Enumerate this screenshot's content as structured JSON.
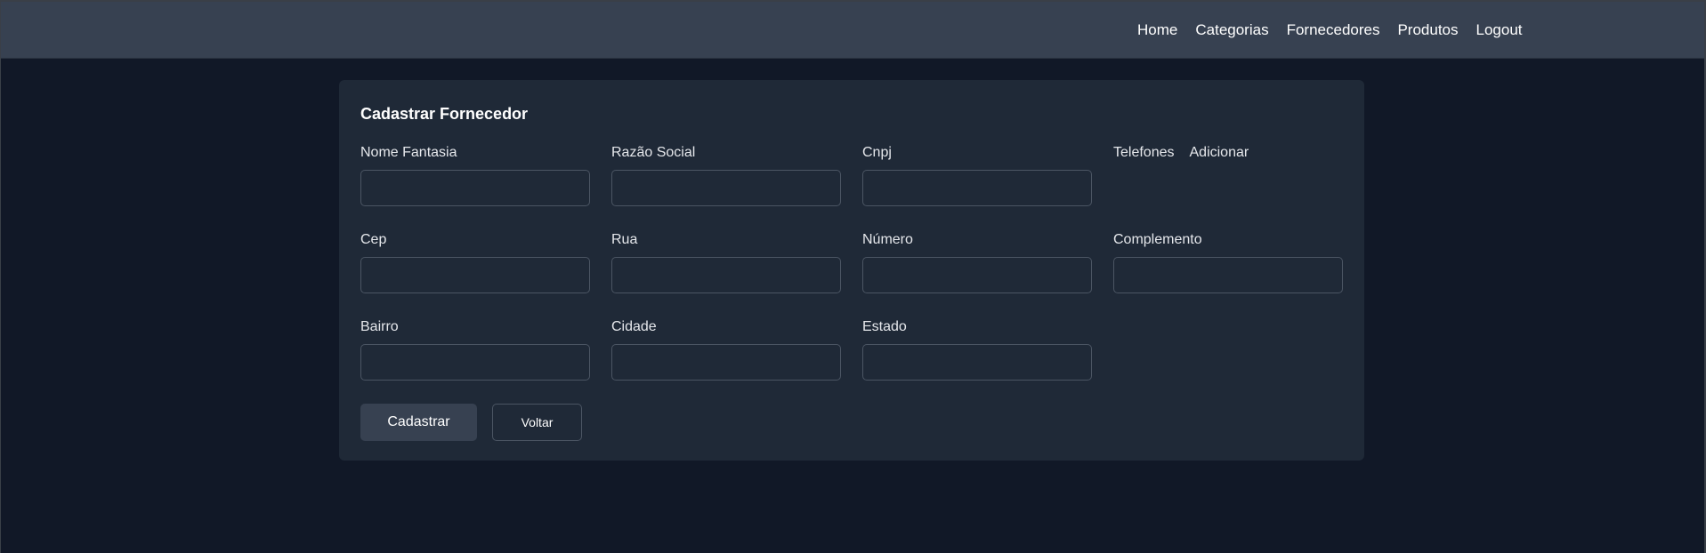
{
  "nav": {
    "items": [
      "Home",
      "Categorias",
      "Fornecedores",
      "Produtos",
      "Logout"
    ]
  },
  "form": {
    "title": "Cadastrar Fornecedor",
    "fields": {
      "nome_fantasia": {
        "label": "Nome Fantasia",
        "value": ""
      },
      "razao_social": {
        "label": "Razão Social",
        "value": ""
      },
      "cnpj": {
        "label": "Cnpj",
        "value": ""
      },
      "cep": {
        "label": "Cep",
        "value": ""
      },
      "rua": {
        "label": "Rua",
        "value": ""
      },
      "numero": {
        "label": "Número",
        "value": ""
      },
      "complemento": {
        "label": "Complemento",
        "value": ""
      },
      "bairro": {
        "label": "Bairro",
        "value": ""
      },
      "cidade": {
        "label": "Cidade",
        "value": ""
      },
      "estado": {
        "label": "Estado",
        "value": ""
      }
    },
    "telefones": {
      "label": "Telefones",
      "add_label": "Adicionar"
    },
    "submit_label": "Cadastrar",
    "back_label": "Voltar"
  },
  "colors": {
    "page_bg": "#111827",
    "navbar_bg": "#374151",
    "card_bg": "#1f2937",
    "input_border": "#4b5563",
    "text": "#ffffff"
  }
}
